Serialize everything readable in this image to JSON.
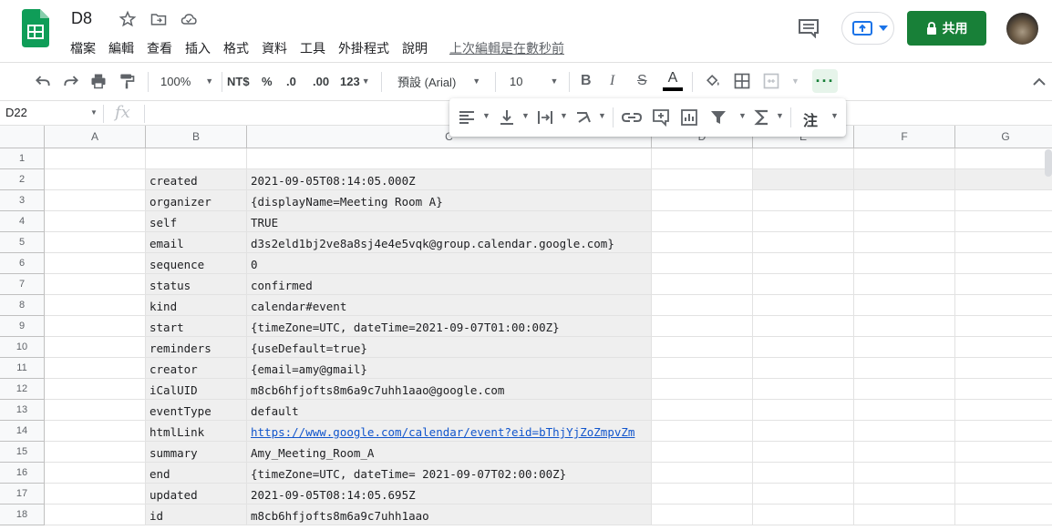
{
  "header": {
    "title": "D8",
    "menu": [
      "檔案",
      "編輯",
      "查看",
      "插入",
      "格式",
      "資料",
      "工具",
      "外掛程式",
      "說明"
    ],
    "last_edit": "上次編輯是在數秒前",
    "share_label": "共用"
  },
  "toolbar": {
    "zoom": "100%",
    "currency": "NT$",
    "percent": "%",
    "dec_decrease": ".0",
    "dec_increase": ".00",
    "number_format": "123",
    "font_family": "預設 (Arial)",
    "font_size": "10",
    "bold": "B",
    "italic": "I",
    "strike": "S",
    "text_color": "A",
    "note_label": "注"
  },
  "formula_bar": {
    "name_box": "D22",
    "fx": "fx",
    "value": ""
  },
  "grid": {
    "columns": [
      "A",
      "B",
      "C",
      "D",
      "E",
      "F",
      "G"
    ],
    "rows": [
      {
        "n": "1",
        "b": "",
        "c": ""
      },
      {
        "n": "2",
        "b": "created",
        "c": "2021-09-05T08:14:05.000Z"
      },
      {
        "n": "3",
        "b": "organizer",
        "c": "{displayName=Meeting Room A}"
      },
      {
        "n": "4",
        "b": "self",
        "c": "TRUE"
      },
      {
        "n": "5",
        "b": "email",
        "c": "d3s2eld1bj2ve8a8sj4e4e5vqk@group.calendar.google.com}"
      },
      {
        "n": "6",
        "b": "sequence",
        "c": "0"
      },
      {
        "n": "7",
        "b": "status",
        "c": "confirmed"
      },
      {
        "n": "8",
        "b": "kind",
        "c": "calendar#event"
      },
      {
        "n": "9",
        "b": "start",
        "c": "{timeZone=UTC, dateTime=2021-09-07T01:00:00Z}"
      },
      {
        "n": "10",
        "b": "reminders",
        "c": "{useDefault=true}"
      },
      {
        "n": "11",
        "b": "creator",
        "c": "{email=amy@gmail}"
      },
      {
        "n": "12",
        "b": "iCalUID",
        "c": "m8cb6hfjofts8m6a9c7uhh1aao@google.com"
      },
      {
        "n": "13",
        "b": "eventType",
        "c": "default"
      },
      {
        "n": "14",
        "b": "htmlLink",
        "c": "https://www.google.com/calendar/event?eid=bThjYjZoZmpvZm"
      },
      {
        "n": "15",
        "b": "summary",
        "c": "Amy_Meeting_Room_A"
      },
      {
        "n": "16",
        "b": "end",
        "c": "{timeZone=UTC, dateTime= 2021-09-07T02:00:00Z}"
      },
      {
        "n": "17",
        "b": "updated",
        "c": "2021-09-05T08:14:05.695Z"
      },
      {
        "n": "18",
        "b": "id",
        "c": "m8cb6hfjofts8m6a9c7uhh1aao"
      }
    ]
  },
  "colors": {
    "share": "#188038",
    "link": "#1155cc",
    "shaded_cell": "#efefef",
    "sheets_green": "#0f9d58"
  }
}
